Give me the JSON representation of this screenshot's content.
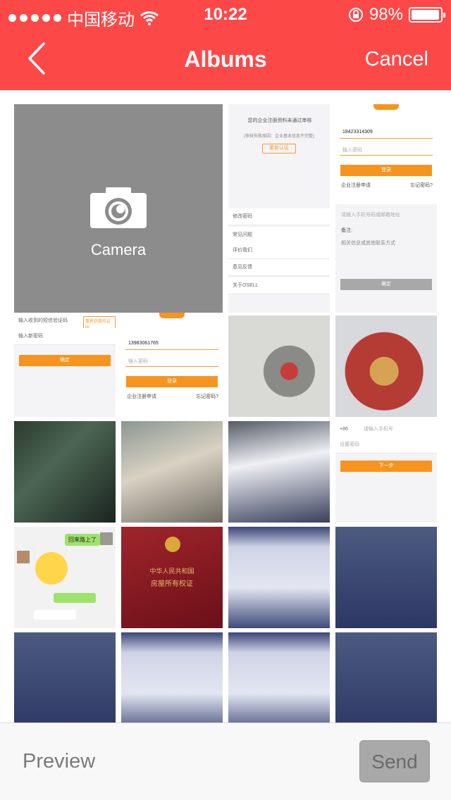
{
  "status_bar": {
    "carrier": "中国移动",
    "time": "10:22",
    "battery": "98%",
    "battery_level": 0.98
  },
  "nav": {
    "title": "Albums",
    "cancel_label": "Cancel",
    "back_icon": "chevron-left-icon"
  },
  "camera_tile": {
    "label": "Camera",
    "icon": "camera-icon"
  },
  "thumbnails": {
    "t1": {
      "line1": "您的企业注册资料未通过审核",
      "line2": "(审核失败原因：企业基本信息不完整)",
      "button": "重新认证",
      "rows": [
        "修改密码",
        "常见问题",
        "评价我们",
        "意见反馈",
        "关于OSELL"
      ]
    },
    "t2": {
      "phone": "18423314309",
      "password_placeholder": "输入密码",
      "login": "登录",
      "register": "企业注册申请",
      "forgot": "忘记密码?",
      "remark_hint": "请输入手机号码或邮箱地址",
      "remark_label": "备注:",
      "remark_text": "相关信息或其他联系方式",
      "confirm": "确定"
    },
    "t3": {
      "code_placeholder": "输入收到的短信验证码",
      "resend": "重新获取验证码",
      "new_password": "输入新密码",
      "confirm": "确定"
    },
    "t4": {
      "phone": "13983061765",
      "password_placeholder": "输入密码",
      "login": "登录",
      "register": "企业注册申请",
      "forgot": "忘记密码?"
    },
    "t5": {
      "country_code": "+86",
      "phone_placeholder": "请输入手机号",
      "password_placeholder": "设置密码",
      "next": "下一步"
    },
    "t6": {
      "bubble": "回来路上了"
    },
    "t7": {
      "line1": "中华人民共和国",
      "line2": "房屋所有权证"
    }
  },
  "toolbar": {
    "preview_label": "Preview",
    "send_label": "Send"
  }
}
